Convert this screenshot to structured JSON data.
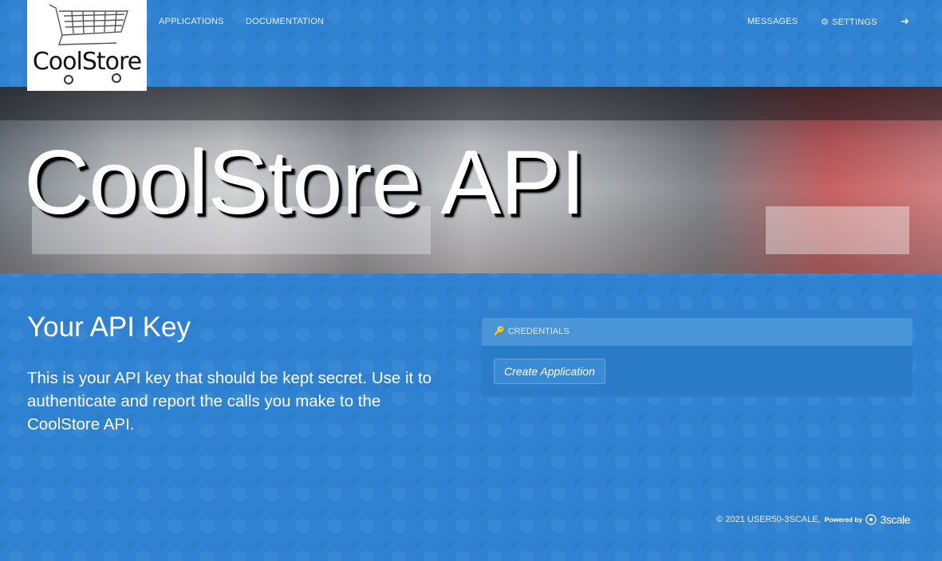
{
  "logo": {
    "text": "CoolStore"
  },
  "nav": {
    "applications": "APPLICATIONS",
    "documentation": "DOCUMENTATION",
    "messages": "MESSAGES",
    "settings": "SETTINGS"
  },
  "hero": {
    "title": "CoolStore API"
  },
  "main": {
    "heading": "Your API Key",
    "description": "This is your API key that should be kept secret. Use it to authenticate and report the calls you make to the CoolStore API."
  },
  "credentials": {
    "header": "CREDENTIALS",
    "button": "Create Application"
  },
  "footer": {
    "copyright": "© 2021 USER50-3SCALE,",
    "powered_by": "Powered by",
    "brand": "3scale"
  },
  "icons": {
    "settings": "gears-icon",
    "logout": "sign-out-icon",
    "credentials": "key-icon",
    "brand": "3scale-logo-icon"
  },
  "colors": {
    "background": "#2e82d1",
    "panel_header": "#4a94d8",
    "button": "#3b8ad4"
  }
}
